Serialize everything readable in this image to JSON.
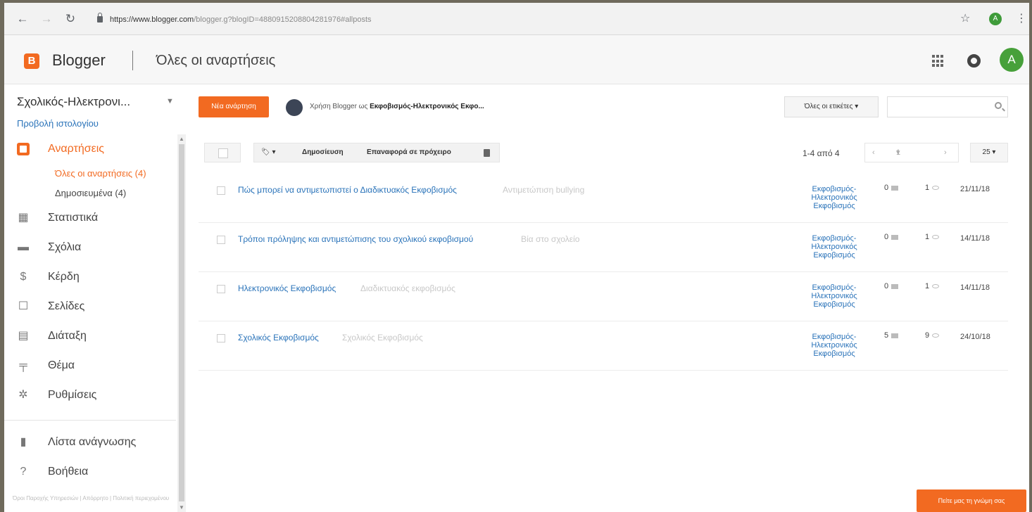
{
  "browser": {
    "back_icon": "back-arrow-icon",
    "url_host": "https://www.blogger.com",
    "url_rest": "/blogger.g?blogID=4880915208804281976#allposts",
    "profile_initial": "A"
  },
  "header": {
    "logo_letter": "B",
    "brand": "Blogger",
    "title": "Όλες οι αναρτήσεις",
    "avatar_initial": "A"
  },
  "sidebar": {
    "blog_name": "Σχολικός-Ηλεκτρονι...",
    "view_blog": "Προβολή ιστολογίου",
    "items": [
      {
        "label": "Αναρτήσεις",
        "icon": "posts-icon"
      },
      {
        "label": "Στατιστικά",
        "icon": "stats-icon"
      },
      {
        "label": "Σχόλια",
        "icon": "comments-icon"
      },
      {
        "label": "Κέρδη",
        "icon": "earnings-icon"
      },
      {
        "label": "Σελίδες",
        "icon": "pages-icon"
      },
      {
        "label": "Διάταξη",
        "icon": "layout-icon"
      },
      {
        "label": "Θέμα",
        "icon": "theme-icon"
      },
      {
        "label": "Ρυθμίσεις",
        "icon": "settings-icon"
      }
    ],
    "sub_items": [
      {
        "label": "Όλες οι αναρτήσεις (4)"
      },
      {
        "label": "Δημοσιευμένα (4)"
      }
    ],
    "bottom_items": [
      {
        "label": "Λίστα ανάγνωσης",
        "icon": "reading-list-icon"
      },
      {
        "label": "Βοήθεια",
        "icon": "help-icon"
      }
    ],
    "footer": "Όροι Παροχής Υπηρεσιών | Απόρρητο | Πολιτική περιεχομένου"
  },
  "main": {
    "new_post": "Νέα ανάρτηση",
    "using_prefix": "Χρήση Blogger ως",
    "using_name": "Εκφοβισμός-Ηλεκτρονικός Εκφο...",
    "labels_dropdown": "Όλες οι ετικέτες",
    "search_placeholder": "",
    "toolbar": {
      "publish": "Δημοσίευση",
      "revert": "Επαναφορά σε πρόχειρο"
    },
    "pager_text": "1-4 από 4",
    "pager_page": "1",
    "per_page": "25",
    "feedback": "Πείτε μας τη γνώμη σας"
  },
  "posts": [
    {
      "title": "Πώς μπορεί να αντιμετωπιστεί ο Διαδικτυακός Εκφοβισμός",
      "snippet": "Αντιμετώπιση bullying",
      "labels": "Εκφοβισμός-Ηλεκτρονικός Εκφοβισμός",
      "comments": "0",
      "views": "1",
      "date": "21/11/18"
    },
    {
      "title": "Τρόποι πρόληψης και αντιμετώπισης του σχολικού εκφοβισμού",
      "snippet": "Βία στο σχολείο",
      "labels": "Εκφοβισμός-Ηλεκτρονικός Εκφοβισμός",
      "comments": "0",
      "views": "1",
      "date": "14/11/18"
    },
    {
      "title": "Ηλεκτρονικός Εκφοβισμός",
      "snippet": "Διαδικτυακός εκφοβισμός",
      "labels": "Εκφοβισμός-Ηλεκτρονικός Εκφοβισμός",
      "comments": "0",
      "views": "1",
      "date": "14/11/18"
    },
    {
      "title": "Σχολικός Εκφοβισμός",
      "snippet": "Σχολικός Εκφοβισμός",
      "labels": "Εκφοβισμός-Ηλεκτρονικός Εκφοβισμός",
      "comments": "5",
      "views": "9",
      "date": "24/10/18"
    }
  ],
  "colors": {
    "accent": "#f26a21",
    "link": "#2a73b9",
    "avatar": "#47a03a"
  }
}
